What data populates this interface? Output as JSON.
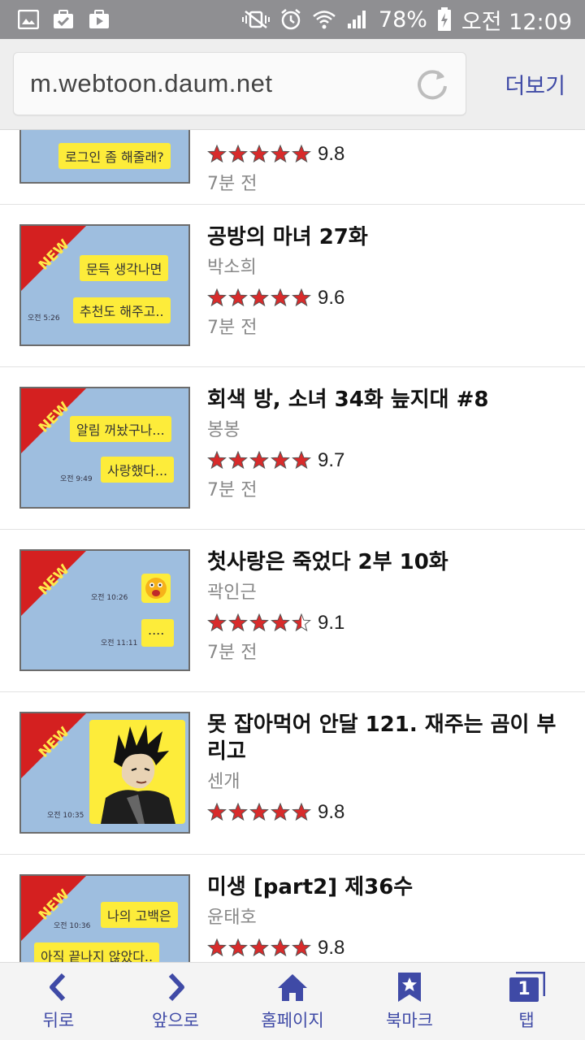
{
  "status_bar": {
    "battery": "78%",
    "time": "오전 12:09"
  },
  "browser": {
    "url": "m.webtoon.daum.net",
    "more_label": "더보기"
  },
  "colors": {
    "accent": "#3f4aa6",
    "star_fill": "#d82b2b",
    "bubble": "#fdec3a",
    "thumb_bg": "#9ebedf"
  },
  "items": [
    {
      "title": "",
      "author": "",
      "rating": 5,
      "score": "9.8",
      "time": "7분 전",
      "thumb": {
        "new": false,
        "bubbles": [
          "로그인 좀 해줄래?"
        ],
        "times": []
      }
    },
    {
      "title": "공방의 마녀 27화",
      "author": "박소희",
      "rating": 5,
      "score": "9.6",
      "time": "7분 전",
      "thumb": {
        "new": true,
        "bubbles": [
          "문득 생각나면",
          "추천도 해주고.."
        ],
        "times": [
          "오전 5:26"
        ]
      }
    },
    {
      "title": "회색 방, 소녀 34화 늪지대 #8",
      "author": "봉봉",
      "rating": 5,
      "score": "9.7",
      "time": "7분 전",
      "thumb": {
        "new": true,
        "bubbles": [
          "알림 꺼놨구나...",
          "사랑했다..."
        ],
        "times": [
          "오전 9:49"
        ]
      }
    },
    {
      "title": "첫사랑은 죽었다 2부 10화",
      "author": "곽인근",
      "rating": 4.5,
      "score": "9.1",
      "time": "7분 전",
      "thumb": {
        "new": true,
        "bubbles": [
          "...."
        ],
        "times": [
          "오전 10:26",
          "오전 11:11"
        ]
      }
    },
    {
      "title": "못 잡아먹어 안달 121. 재주는 곰이 부리고",
      "author": "센개",
      "rating": 5,
      "score": "9.8",
      "time": "",
      "thumb": {
        "new": true,
        "bubbles": [],
        "times": [
          "오전 10:35"
        ]
      }
    },
    {
      "title": "미생 [part2] 제36수",
      "author": "윤태호",
      "rating": 5,
      "score": "9.8",
      "time": "",
      "thumb": {
        "new": true,
        "bubbles": [
          "나의 고백은",
          "아직 끝나지 않았다.."
        ],
        "times": [
          "오전 10:36"
        ]
      }
    }
  ],
  "nav": {
    "back": "뒤로",
    "forward": "앞으로",
    "home": "홈페이지",
    "bookmark": "북마크",
    "tabs": "탭",
    "tab_count": "1"
  }
}
